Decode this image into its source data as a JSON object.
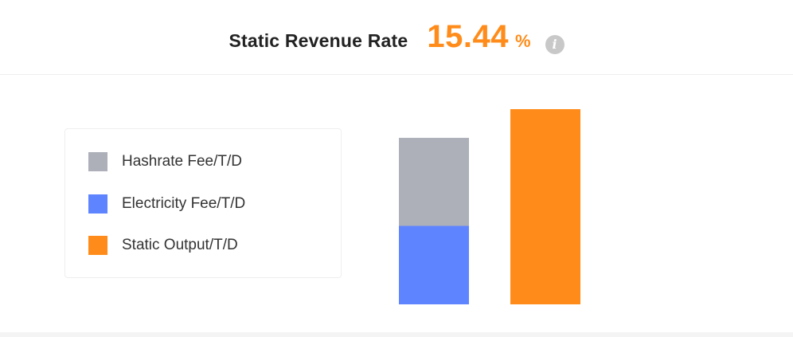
{
  "header": {
    "title": "Static Revenue Rate",
    "rate_value": "15.44",
    "rate_unit": "%",
    "info_icon_glyph": "i",
    "accent_color": "#ff8c1a"
  },
  "legend": {
    "items": [
      {
        "label": "Hashrate Fee/T/D",
        "color": "#adafb9"
      },
      {
        "label": "Electricity Fee/T/D",
        "color": "#5f84ff"
      },
      {
        "label": "Static Output/T/D",
        "color": "#ff8c1a"
      }
    ]
  },
  "chart_data": {
    "type": "bar",
    "stacked": true,
    "categories": [
      "",
      ""
    ],
    "series": [
      {
        "name": "Electricity Fee/T/D",
        "values": [
          41,
          0
        ],
        "color": "#5f84ff"
      },
      {
        "name": "Hashrate Fee/T/D",
        "values": [
          46,
          0
        ],
        "color": "#adafb9"
      },
      {
        "name": "Static Output/T/D",
        "values": [
          0,
          102
        ],
        "color": "#ff8c1a"
      }
    ],
    "ylim": [
      0,
      102
    ],
    "grid": false
  }
}
